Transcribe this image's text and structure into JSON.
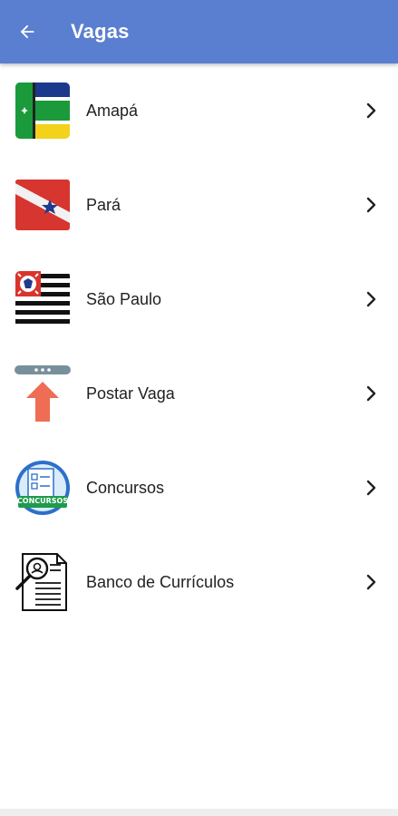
{
  "appbar": {
    "title": "Vagas",
    "background": "#5a7fd0",
    "back_icon": "arrow-left-icon"
  },
  "items": [
    {
      "label": "Amapá",
      "icon": "amapa-flag-icon"
    },
    {
      "label": "Pará",
      "icon": "para-flag-icon"
    },
    {
      "label": "São Paulo",
      "icon": "sao-paulo-flag-icon"
    },
    {
      "label": "Postar Vaga",
      "icon": "upload-arrow-icon"
    },
    {
      "label": "Concursos",
      "icon": "concursos-badge-icon",
      "badge_text": "CONCURSOS"
    },
    {
      "label": "Banco de Currículos",
      "icon": "resume-search-icon"
    }
  ],
  "chevron_icon": "chevron-right-icon"
}
